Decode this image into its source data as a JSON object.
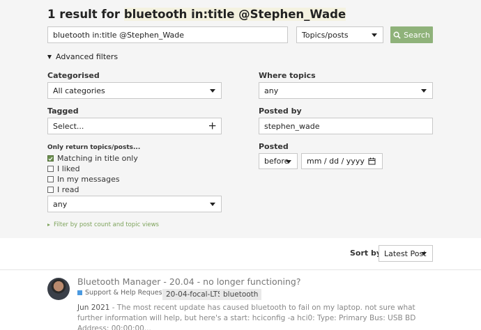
{
  "heading": {
    "prefix": "1 result for ",
    "query": "bluetooth in:title @Stephen_Wade"
  },
  "search": {
    "input_value": "bluetooth in:title @Stephen_Wade",
    "scope": "Topics/posts",
    "button_label": "Search"
  },
  "advanced": {
    "toggle_label": "Advanced filters",
    "categorised_label": "Categorised",
    "categorised_value": "All categories",
    "tagged_label": "Tagged",
    "tagged_value": "Select...",
    "only_return_label": "Only return topics/posts...",
    "checks": [
      {
        "label": "Matching in title only",
        "checked": true
      },
      {
        "label": "I liked",
        "checked": false
      },
      {
        "label": "In my messages",
        "checked": false
      },
      {
        "label": "I read",
        "checked": false
      }
    ],
    "status_value": "any",
    "where_topics_label": "Where topics",
    "where_topics_value": "any",
    "posted_by_label": "Posted by",
    "posted_by_value": "stephen_wade",
    "posted_label": "Posted",
    "posted_when": "before",
    "posted_date_placeholder": "mm / dd / yyyy",
    "post_count_link": "Filter by post count and topic views"
  },
  "sort": {
    "label": "Sort by",
    "value": "Latest Post"
  },
  "result": {
    "title": "Bluetooth Manager - 20.04 - no longer functioning?",
    "category": "Support & Help Requests",
    "category_color": "#4b9ae0",
    "tags": [
      "20-04-focal-LTS",
      "bluetooth"
    ],
    "date": "Jun 2021",
    "blurb": " - The most recent update has caused bluetooth to fail on my laptop. not sure what further information will help, but here's a start: hciconfig -a hci0: Type: Primary Bus: USB BD Address: 00:00:00..."
  },
  "colors": {
    "accent": "#8fb27a",
    "link": "#7da35b",
    "panel": "#f5f5f5"
  }
}
